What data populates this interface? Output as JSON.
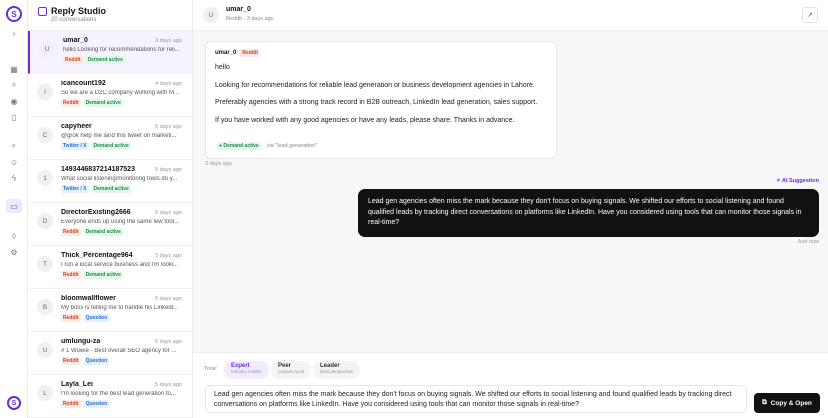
{
  "app": {
    "title": "Reply Studio",
    "subtitle": "20 conversations",
    "logo_letter": "S"
  },
  "rail": {
    "icons": [
      "chevron-right-icon",
      "grid-icon",
      "search-icon",
      "rss-icon",
      "phone-icon",
      "search-icon",
      "users-icon",
      "bolt-icon",
      "chat-icon",
      "shield-icon",
      "settings-icon"
    ]
  },
  "conversations": [
    {
      "initial": "U",
      "name": "umar_0",
      "time": "3 days ago",
      "preview": "hello Looking for recommendations for reli...",
      "tags": [
        [
          "reddit",
          "Reddit"
        ],
        [
          "demand",
          "Demand active"
        ]
      ]
    },
    {
      "initial": "I",
      "name": "icancount192",
      "time": "4 days ago",
      "preview": "So we are a D2C company working with M...",
      "tags": [
        [
          "reddit",
          "Reddit"
        ],
        [
          "demand",
          "Demand active"
        ]
      ]
    },
    {
      "initial": "C",
      "name": "capyheer",
      "time": "5 days ago",
      "preview": "@grok help me land this tweet on marketi...",
      "tags": [
        [
          "twitter",
          "Twitter / X"
        ],
        [
          "demand",
          "Demand active"
        ]
      ]
    },
    {
      "initial": "1",
      "name": "1493446837214187523",
      "time": "5 days ago",
      "preview": "What social listening/monitoring tools do y...",
      "tags": [
        [
          "twitter",
          "Twitter / X"
        ],
        [
          "demand",
          "Demand active"
        ]
      ]
    },
    {
      "initial": "D",
      "name": "DirectorExisting2666",
      "time": "5 days ago",
      "preview": "Everyone ends up using the same few tool...",
      "tags": [
        [
          "reddit",
          "Reddit"
        ],
        [
          "demand",
          "Demand active"
        ]
      ]
    },
    {
      "initial": "T",
      "name": "Thick_Percentage964",
      "time": "5 days ago",
      "preview": "I run a local service business and I'm looki...",
      "tags": [
        [
          "reddit",
          "Reddit"
        ],
        [
          "demand",
          "Demand active"
        ]
      ]
    },
    {
      "initial": "B",
      "name": "bloomwallflower",
      "time": "5 days ago",
      "preview": "My boss is telling me to handle his Linkedl...",
      "tags": [
        [
          "reddit",
          "Reddit"
        ],
        [
          "question",
          "Question"
        ]
      ]
    },
    {
      "initial": "U",
      "name": "umlungu-za",
      "time": "5 days ago",
      "preview": "# 1 Wowie - Best overall SEO agency for ...",
      "tags": [
        [
          "reddit",
          "Reddit"
        ],
        [
          "question",
          "Question"
        ]
      ]
    },
    {
      "initial": "L",
      "name": "Layla_Lei",
      "time": "5 days ago",
      "preview": "I'm looking for the best lead generation to...",
      "tags": [
        [
          "reddit",
          "Reddit"
        ],
        [
          "question",
          "Question"
        ]
      ]
    }
  ],
  "thread": {
    "initial": "U",
    "name": "umar_0",
    "meta": "Reddit · 3 days ago",
    "message": {
      "name": "umar_0",
      "source_tag": "Reddit",
      "paragraphs": [
        "hello",
        "Looking for recommendations for reliable lead generation or business development agencies in Lahore.",
        "Preferably agencies with a strong track record in B2B outreach, LinkedIn lead generation,  sales support.",
        "If you have worked with any good agencies or have any leads, please share. Thanks in advance."
      ],
      "intent_tag": "Demand active",
      "via": "via \"lead generation\"",
      "time": "3 days ago"
    },
    "ai": {
      "label": "AI Suggestion",
      "text": "Lead gen agencies often miss the mark because they don't focus on buying signals. We shifted our efforts to social listening and found qualified leads by tracking direct conversations on platforms like LinkedIn. Have you considered using tools that can monitor those signals in real-time?",
      "time": "Just now"
    }
  },
  "composer": {
    "tone_label": "Tone:",
    "tones": [
      {
        "name": "Expert",
        "desc": "Industry insider"
      },
      {
        "name": "Peer",
        "desc": "Casual equal"
      },
      {
        "name": "Leader",
        "desc": "Bold perspective"
      }
    ],
    "draft": "Lead gen agencies often miss the mark because they don't focus on buying signals. We shifted our efforts to social listening and found qualified leads by tracking direct conversations on platforms like LinkedIn. Have you considered using tools that can monitor those signals in real-time?",
    "copy_button": "Copy & Open"
  },
  "colors": {
    "accent": "#6b2bd9",
    "dark": "#111111"
  }
}
